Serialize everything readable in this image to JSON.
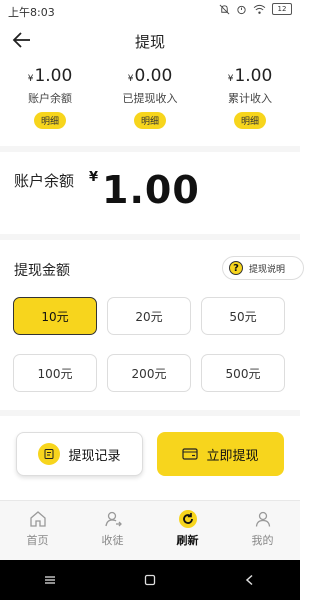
{
  "status_bar": {
    "time": "上午8:03",
    "battery": "12"
  },
  "header": {
    "title": "提现"
  },
  "stats": [
    {
      "currency": "¥",
      "value": "1.00",
      "label": "账户余额",
      "detail": "明细"
    },
    {
      "currency": "¥",
      "value": "0.00",
      "label": "已提现收入",
      "detail": "明细"
    },
    {
      "currency": "¥",
      "value": "1.00",
      "label": "累计收入",
      "detail": "明细"
    }
  ],
  "balance": {
    "label": "账户余额",
    "currency": "¥",
    "value": "1.00"
  },
  "withdraw_section": {
    "label": "提现金额",
    "help_label": "提现说明",
    "help_icon_text": "?",
    "amounts": [
      "10元",
      "20元",
      "50元",
      "100元",
      "200元",
      "500元"
    ],
    "selected_index": 0
  },
  "actions": {
    "record_label": "提现记录",
    "withdraw_label": "立即提现"
  },
  "tabs": [
    {
      "label": "首页",
      "icon": "home-icon"
    },
    {
      "label": "收徒",
      "icon": "invite-icon"
    },
    {
      "label": "刷新",
      "icon": "refresh-icon",
      "active": true
    },
    {
      "label": "我的",
      "icon": "profile-icon"
    }
  ],
  "colors": {
    "accent": "#f7d51d",
    "background": "#ffffff"
  }
}
